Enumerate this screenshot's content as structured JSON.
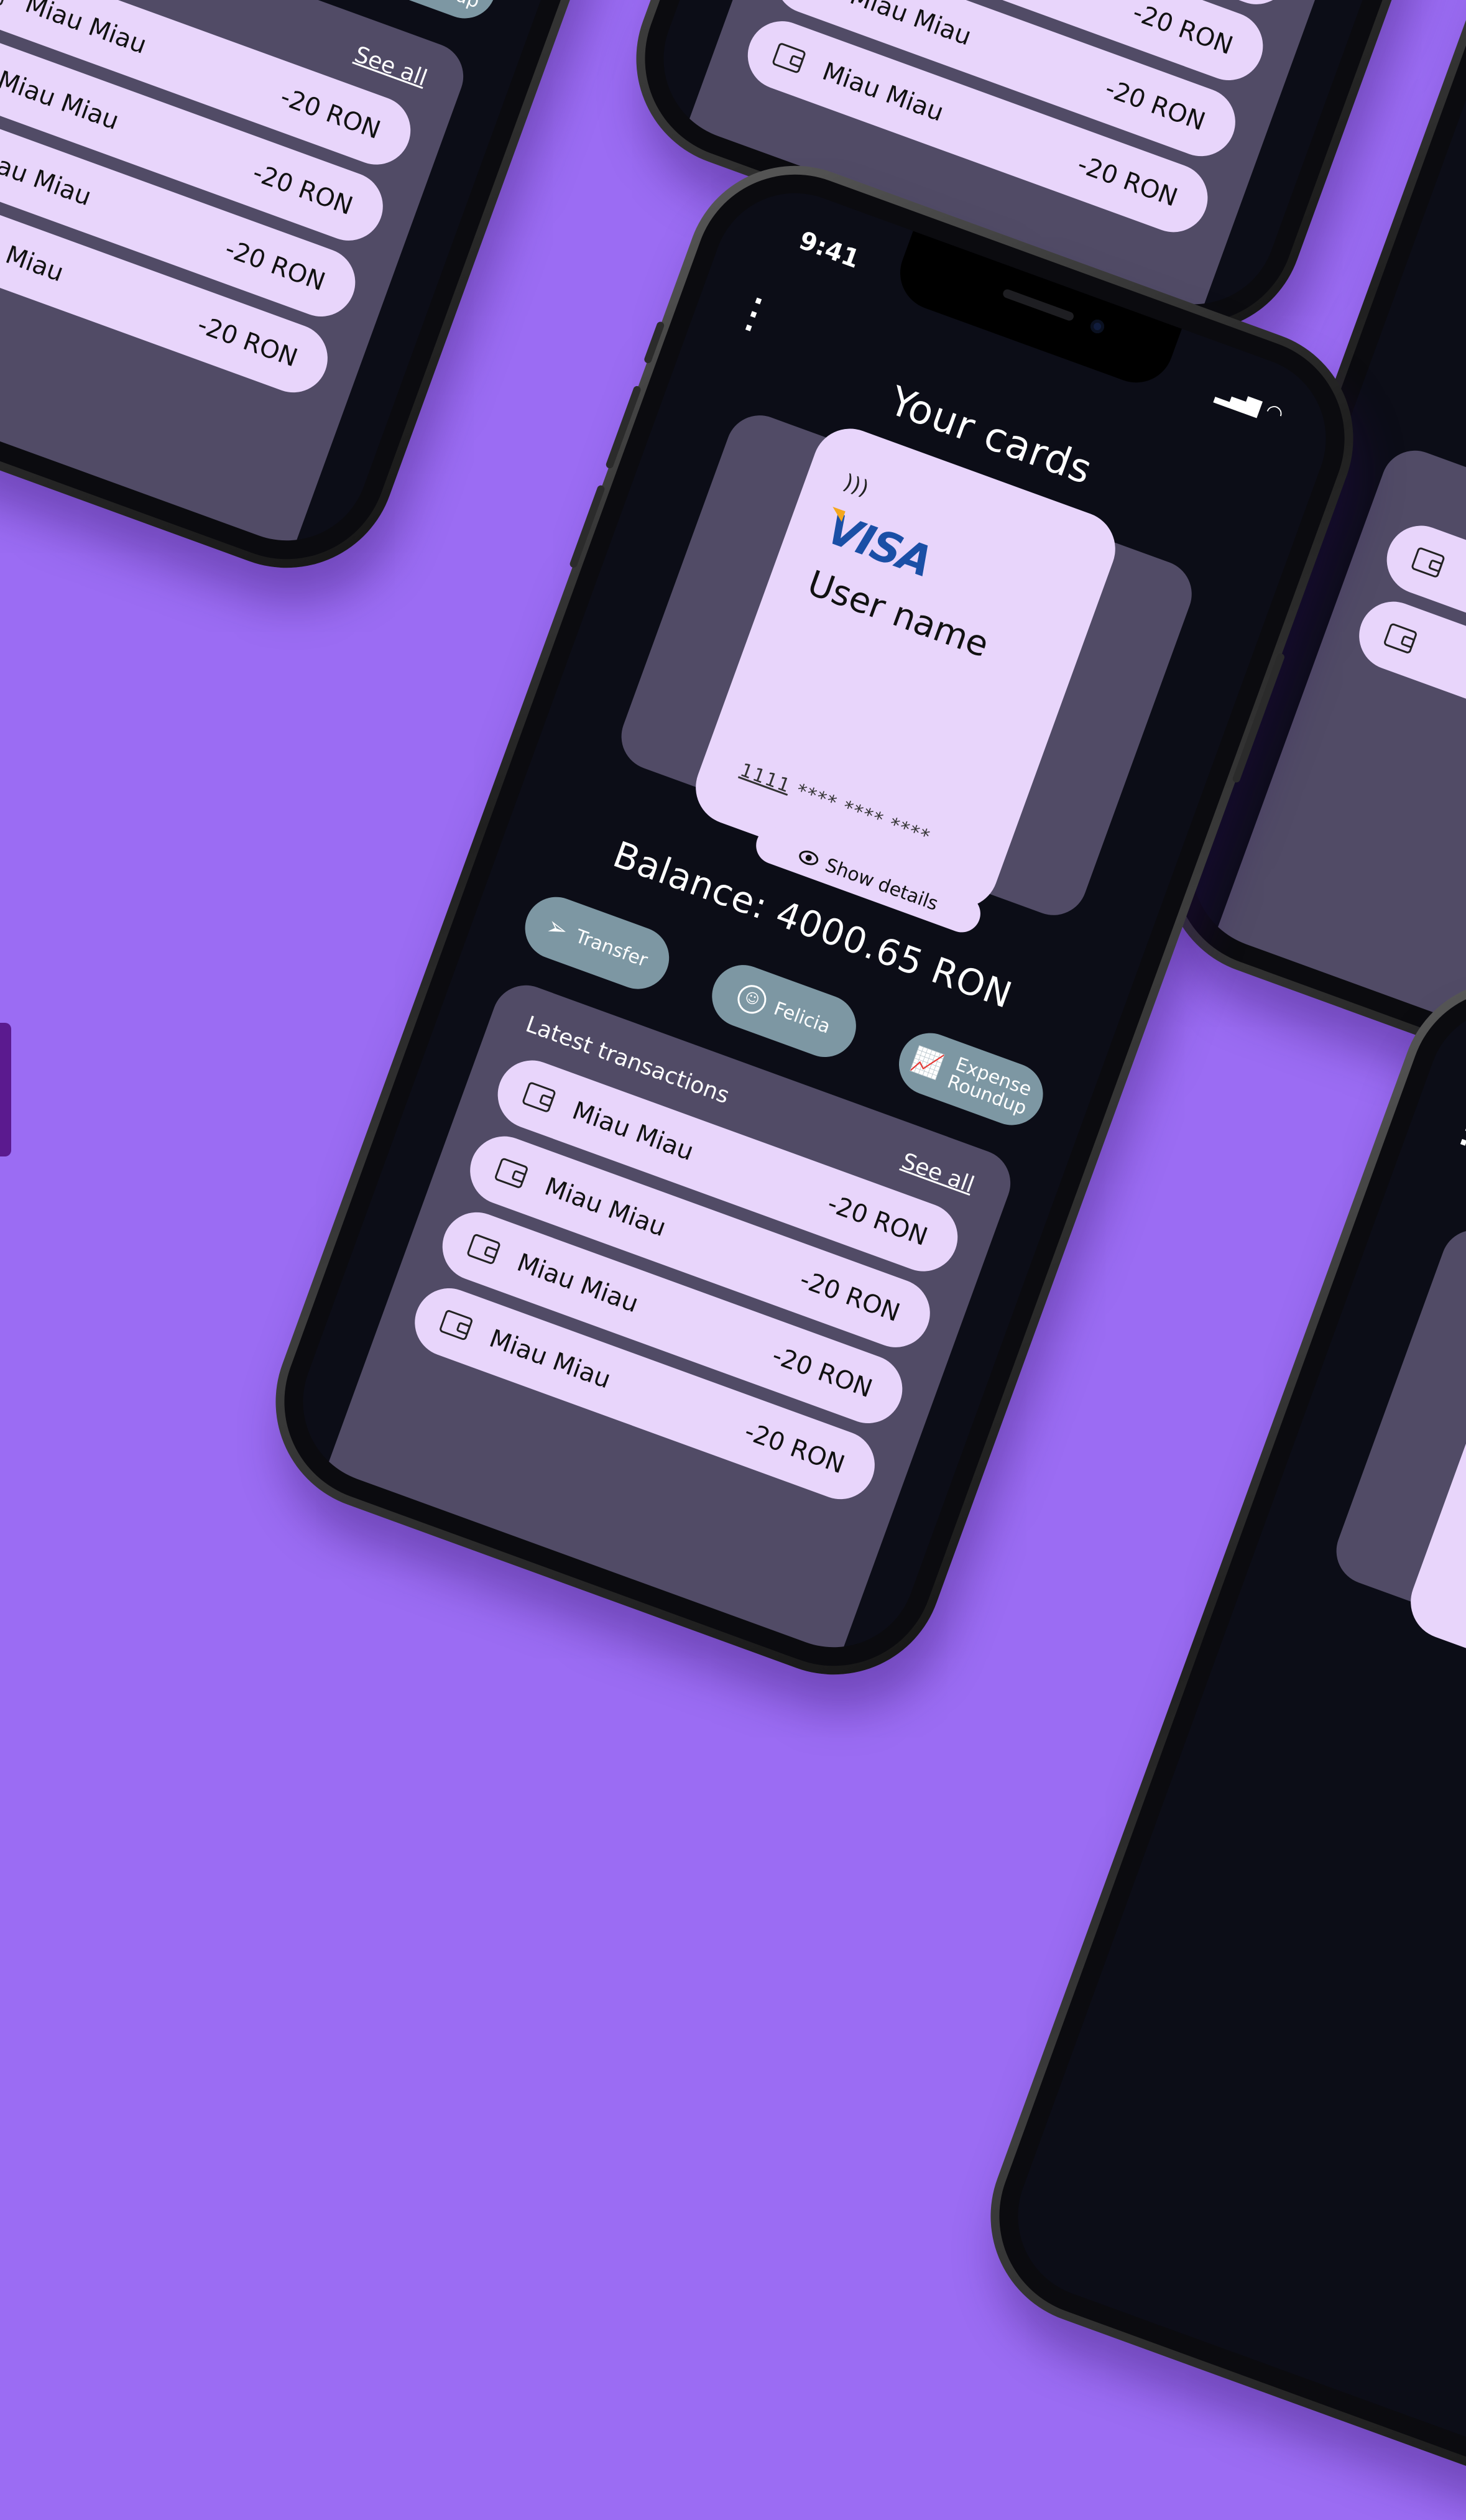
{
  "app": {
    "time": "9:41",
    "title": "Your cards",
    "card": {
      "brand": "VISA",
      "holder": "User name",
      "number_first": "1111",
      "number_masked": "**** **** ****"
    },
    "show_details": "Show details",
    "balance": "Balance: 4000.65 RON",
    "actions": [
      {
        "label": "Transfer"
      },
      {
        "label": "Felicia"
      },
      {
        "label_line1": "Expense",
        "label_line2": "Roundup"
      }
    ],
    "transactions": {
      "label": "Latest transactions",
      "see_all": "See all",
      "items": [
        {
          "name": "Miau Miau",
          "amount": "-20 RON"
        },
        {
          "name": "Miau Miau",
          "amount": "-20 RON"
        },
        {
          "name": "Miau Miau",
          "amount": "-20 RON"
        },
        {
          "name": "Miau Miau",
          "amount": "-20 RON"
        }
      ]
    }
  },
  "colors": {
    "background": "#9b6cf3",
    "screen": "#0c0d17",
    "panel": "#514b66",
    "card": "#e8d5fb",
    "action": "#7d97a3"
  }
}
